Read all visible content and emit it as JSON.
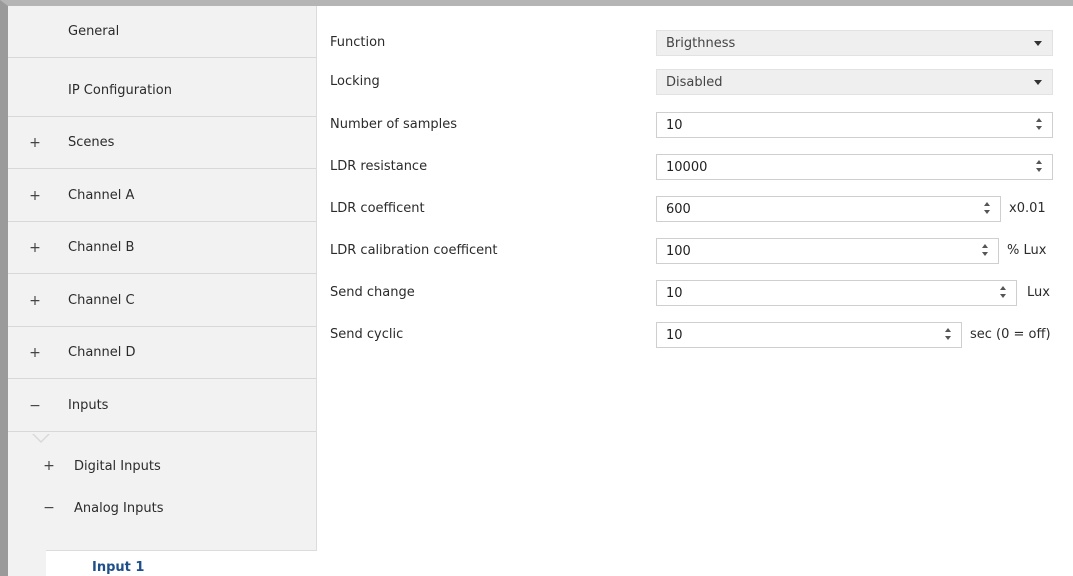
{
  "sidebar": {
    "items": [
      {
        "sign": "",
        "label": "General"
      },
      {
        "sign": "",
        "label": "IP Configuration"
      },
      {
        "sign": "+",
        "label": "Scenes"
      },
      {
        "sign": "+",
        "label": "Channel A"
      },
      {
        "sign": "+",
        "label": "Channel B"
      },
      {
        "sign": "+",
        "label": "Channel C"
      },
      {
        "sign": "+",
        "label": "Channel D"
      },
      {
        "sign": "−",
        "label": "Inputs"
      }
    ],
    "sub_items": [
      {
        "sign": "+",
        "label": "Digital Inputs"
      },
      {
        "sign": "−",
        "label": "Analog Inputs"
      }
    ],
    "selected": {
      "label": "Input 1"
    }
  },
  "params": {
    "function": {
      "label": "Function",
      "value": "Brigthness"
    },
    "locking": {
      "label": "Locking",
      "value": "Disabled"
    },
    "samples": {
      "label": "Number of samples",
      "value": "10"
    },
    "ldr_resistance": {
      "label": "LDR resistance",
      "value": "10000"
    },
    "ldr_coefficient": {
      "label": "LDR coefficent",
      "value": "600",
      "unit": "x0.01"
    },
    "ldr_calibration": {
      "label": "LDR calibration coefficent",
      "value": "100",
      "unit": "% Lux"
    },
    "send_change": {
      "label": "Send change",
      "value": "10",
      "unit": "Lux"
    },
    "send_cyclic": {
      "label": "Send cyclic",
      "value": "10",
      "unit": "sec (0 = off)"
    }
  },
  "colors": {
    "sidebar_bg": "#f2f2f2",
    "selected_text": "#1f4f8a",
    "select_bg": "#efefef"
  }
}
